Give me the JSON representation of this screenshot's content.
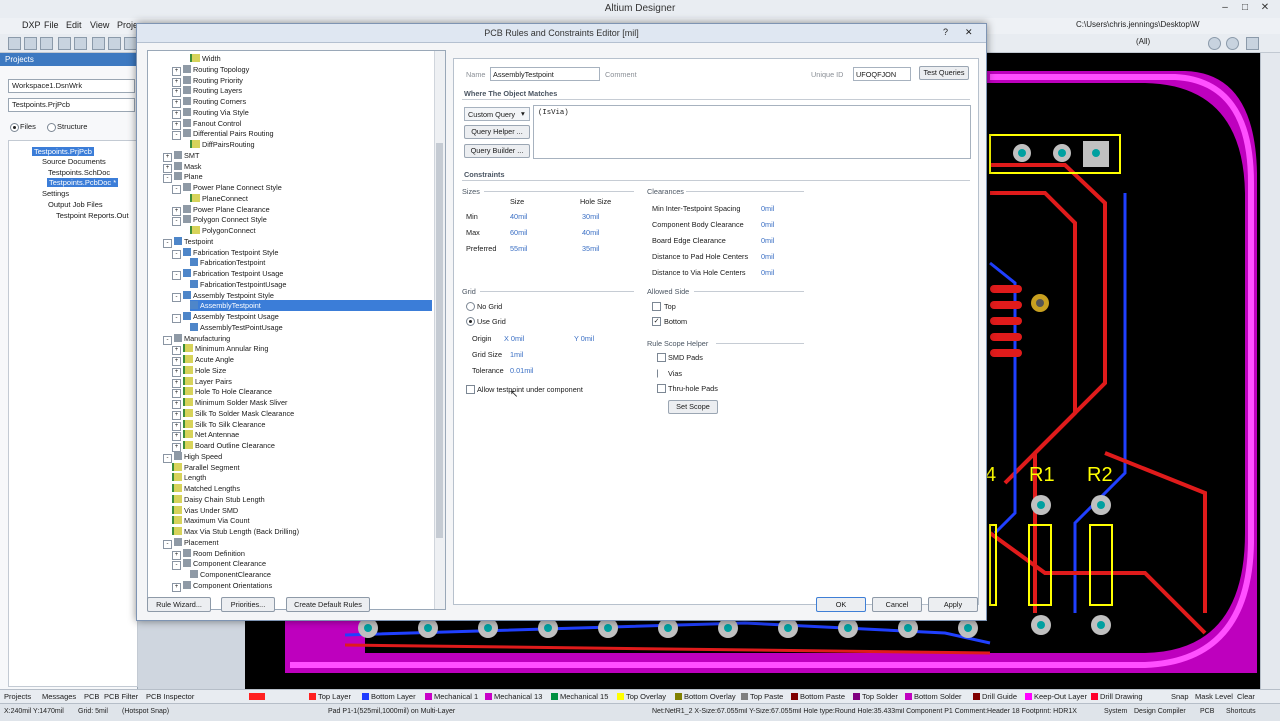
{
  "app": {
    "title": "Altium Designer",
    "path": "C:\\Users\\chris.jennings\\Desktop\\W",
    "filter": "(All)",
    "menus": [
      "DXP",
      "File",
      "Edit",
      "View",
      "Proje"
    ]
  },
  "projects_panel": {
    "header": "Projects",
    "workspace": "Workspace1.DsnWrk",
    "project_field": "Testpoints.PrjPcb",
    "view_files": "Files",
    "view_structure": "Structure",
    "tree": [
      "Testpoints.PrjPcb",
      "Source Documents",
      "Testpoints.SchDoc",
      "Testpoints.PcbDoc *",
      "Settings",
      "Output Job Files",
      "Testpoint Reports.Out"
    ]
  },
  "dialog": {
    "title": "PCB Rules and Constraints Editor [mil]",
    "help": "?",
    "close": "✕",
    "tree": [
      {
        "label": "Width",
        "indent": 4,
        "icon": "rule"
      },
      {
        "label": "Routing Topology",
        "indent": 2,
        "icon": "folder",
        "ex": "+"
      },
      {
        "label": "Routing Priority",
        "indent": 2,
        "icon": "folder",
        "ex": "+"
      },
      {
        "label": "Routing Layers",
        "indent": 2,
        "icon": "folder",
        "ex": "+"
      },
      {
        "label": "Routing Corners",
        "indent": 2,
        "icon": "folder",
        "ex": "+"
      },
      {
        "label": "Routing Via Style",
        "indent": 2,
        "icon": "folder",
        "ex": "+"
      },
      {
        "label": "Fanout Control",
        "indent": 2,
        "icon": "folder",
        "ex": "+"
      },
      {
        "label": "Differential Pairs Routing",
        "indent": 2,
        "icon": "folder",
        "ex": "-"
      },
      {
        "label": "DiffPairsRouting",
        "indent": 4,
        "icon": "rule"
      },
      {
        "label": "SMT",
        "indent": 1,
        "icon": "folder",
        "ex": "+"
      },
      {
        "label": "Mask",
        "indent": 1,
        "icon": "folder",
        "ex": "+"
      },
      {
        "label": "Plane",
        "indent": 1,
        "icon": "folder",
        "ex": "-"
      },
      {
        "label": "Power Plane Connect Style",
        "indent": 2,
        "icon": "folder",
        "ex": "-"
      },
      {
        "label": "PlaneConnect",
        "indent": 4,
        "icon": "rule"
      },
      {
        "label": "Power Plane Clearance",
        "indent": 2,
        "icon": "folder",
        "ex": "+"
      },
      {
        "label": "Polygon Connect Style",
        "indent": 2,
        "icon": "folder",
        "ex": "-"
      },
      {
        "label": "PolygonConnect",
        "indent": 4,
        "icon": "rule"
      },
      {
        "label": "Testpoint",
        "indent": 1,
        "icon": "check",
        "ex": "-"
      },
      {
        "label": "Fabrication Testpoint Style",
        "indent": 2,
        "icon": "check",
        "ex": "-"
      },
      {
        "label": "FabricationTestpoint",
        "indent": 4,
        "icon": "check"
      },
      {
        "label": "Fabrication Testpoint Usage",
        "indent": 2,
        "icon": "check",
        "ex": "-"
      },
      {
        "label": "FabricationTestpointUsage",
        "indent": 4,
        "icon": "check"
      },
      {
        "label": "Assembly Testpoint Style",
        "indent": 2,
        "icon": "check",
        "ex": "-"
      },
      {
        "label": "AssemblyTestpoint",
        "indent": 4,
        "icon": "check",
        "selected": true
      },
      {
        "label": "Assembly Testpoint Usage",
        "indent": 2,
        "icon": "check",
        "ex": "-"
      },
      {
        "label": "AssemblyTestPointUsage",
        "indent": 4,
        "icon": "check"
      },
      {
        "label": "Manufacturing",
        "indent": 1,
        "icon": "folder",
        "ex": "-"
      },
      {
        "label": "Minimum Annular Ring",
        "indent": 2,
        "icon": "rule",
        "ex": "+"
      },
      {
        "label": "Acute Angle",
        "indent": 2,
        "icon": "rule",
        "ex": "+"
      },
      {
        "label": "Hole Size",
        "indent": 2,
        "icon": "rule",
        "ex": "+"
      },
      {
        "label": "Layer Pairs",
        "indent": 2,
        "icon": "rule",
        "ex": "+"
      },
      {
        "label": "Hole To Hole Clearance",
        "indent": 2,
        "icon": "rule",
        "ex": "+"
      },
      {
        "label": "Minimum Solder Mask Sliver",
        "indent": 2,
        "icon": "rule",
        "ex": "+"
      },
      {
        "label": "Silk To Solder Mask Clearance",
        "indent": 2,
        "icon": "rule",
        "ex": "+"
      },
      {
        "label": "Silk To Silk Clearance",
        "indent": 2,
        "icon": "rule",
        "ex": "+"
      },
      {
        "label": "Net Antennae",
        "indent": 2,
        "icon": "rule",
        "ex": "+"
      },
      {
        "label": "Board Outline Clearance",
        "indent": 2,
        "icon": "rule",
        "ex": "+"
      },
      {
        "label": "High Speed",
        "indent": 1,
        "icon": "folder",
        "ex": "-"
      },
      {
        "label": "Parallel Segment",
        "indent": 2,
        "icon": "rule"
      },
      {
        "label": "Length",
        "indent": 2,
        "icon": "rule"
      },
      {
        "label": "Matched Lengths",
        "indent": 2,
        "icon": "rule"
      },
      {
        "label": "Daisy Chain Stub Length",
        "indent": 2,
        "icon": "rule"
      },
      {
        "label": "Vias Under SMD",
        "indent": 2,
        "icon": "rule"
      },
      {
        "label": "Maximum Via Count",
        "indent": 2,
        "icon": "rule"
      },
      {
        "label": "Max Via Stub Length (Back Drilling)",
        "indent": 2,
        "icon": "rule"
      },
      {
        "label": "Placement",
        "indent": 1,
        "icon": "folder",
        "ex": "-"
      },
      {
        "label": "Room Definition",
        "indent": 2,
        "icon": "folder",
        "ex": "+"
      },
      {
        "label": "Component Clearance",
        "indent": 2,
        "icon": "folder",
        "ex": "-"
      },
      {
        "label": "ComponentClearance",
        "indent": 4,
        "icon": "folder"
      },
      {
        "label": "Component Orientations",
        "indent": 2,
        "icon": "folder",
        "ex": "+"
      }
    ],
    "rule": {
      "name_label": "Name",
      "name_value": "AssemblyTestpoint",
      "comment_label": "Comment",
      "unique_id_label": "Unique ID",
      "unique_id_value": "UFOQFJON",
      "test_queries": "Test Queries",
      "where_header": "Where The Object Matches",
      "query_mode": "Custom Query",
      "query_text": "(IsVia)",
      "query_helper": "Query Helper ...",
      "query_builder": "Query Builder ..."
    },
    "constraints": {
      "header": "Constraints",
      "sizes_header": "Sizes",
      "col_size": "Size",
      "col_hole": "Hole Size",
      "rows": [
        {
          "label": "Min",
          "size": "40mil",
          "hole": "30mil"
        },
        {
          "label": "Max",
          "size": "60mil",
          "hole": "40mil"
        },
        {
          "label": "Preferred",
          "size": "55mil",
          "hole": "35mil"
        }
      ],
      "clearances_header": "Clearances",
      "clearances": [
        {
          "label": "Min Inter-Testpoint Spacing",
          "value": "0mil"
        },
        {
          "label": "Component Body Clearance",
          "value": "0mil"
        },
        {
          "label": "Board Edge Clearance",
          "value": "0mil"
        },
        {
          "label": "Distance to Pad Hole Centers",
          "value": "0mil"
        },
        {
          "label": "Distance to Via Hole Centers",
          "value": "0mil"
        }
      ],
      "grid_header": "Grid",
      "no_grid": "No Grid",
      "use_grid": "Use Grid",
      "origin_label": "Origin",
      "origin_x": "X 0mil",
      "origin_y": "Y 0mil",
      "grid_size_label": "Grid Size",
      "grid_size": "1mil",
      "tolerance_label": "Tolerance",
      "tolerance": "0.01mil",
      "allow_under": "Allow testpoint under component",
      "allowed_side_header": "Allowed Side",
      "top": "Top",
      "bottom": "Bottom",
      "scope_header": "Rule Scope Helper",
      "smd_pads": "SMD Pads",
      "vias": "Vias",
      "thru_hole": "Thru-hole Pads",
      "set_scope": "Set Scope"
    },
    "footer": {
      "rule_wizard": "Rule Wizard...",
      "priorities": "Priorities...",
      "create_default": "Create Default Rules",
      "ok": "OK",
      "cancel": "Cancel",
      "apply": "Apply"
    }
  },
  "pcb": {
    "labels": [
      "4",
      "R1",
      "R2"
    ]
  },
  "panel_tabs": [
    "Projects",
    "Messages",
    "PCB",
    "PCB Filter",
    "PCB Inspector"
  ],
  "layers": [
    {
      "name": "Top Layer",
      "color": "#ff2020"
    },
    {
      "name": "Bottom Layer",
      "color": "#1f3cff"
    },
    {
      "name": "Mechanical 1",
      "color": "#c800c8"
    },
    {
      "name": "Mechanical 13",
      "color": "#c800c8"
    },
    {
      "name": "Mechanical 15",
      "color": "#009040"
    },
    {
      "name": "Top Overlay",
      "color": "#ffff00"
    },
    {
      "name": "Bottom Overlay",
      "color": "#808000"
    },
    {
      "name": "Top Paste",
      "color": "#808080"
    },
    {
      "name": "Bottom Paste",
      "color": "#800000"
    },
    {
      "name": "Top Solder",
      "color": "#800080"
    },
    {
      "name": "Bottom Solder",
      "color": "#c000c0"
    },
    {
      "name": "Drill Guide",
      "color": "#800000"
    },
    {
      "name": "Keep-Out Layer",
      "color": "#ff00ff"
    },
    {
      "name": "Drill Drawing",
      "color": "#ff002a"
    }
  ],
  "right_tabs": [
    "Snap",
    "Mask Level",
    "Clear"
  ],
  "status": {
    "coords": "X:240mil Y:1470mil",
    "grid": "Grid: 5mil",
    "snap": "(Hotspot Snap)",
    "pad": "Pad P1-1(525mil,1000mil) on Multi-Layer",
    "net": "Net:NetR1_2  X-Size:67.055mil Y-Size:67.055mil Hole type:Round Hole:35.433mil    Component P1 Comment:Header 18 Footprint: HDR1X",
    "sys": "System",
    "dc": "Design Compiler",
    "pcb": "PCB",
    "short": "Shortcuts"
  }
}
